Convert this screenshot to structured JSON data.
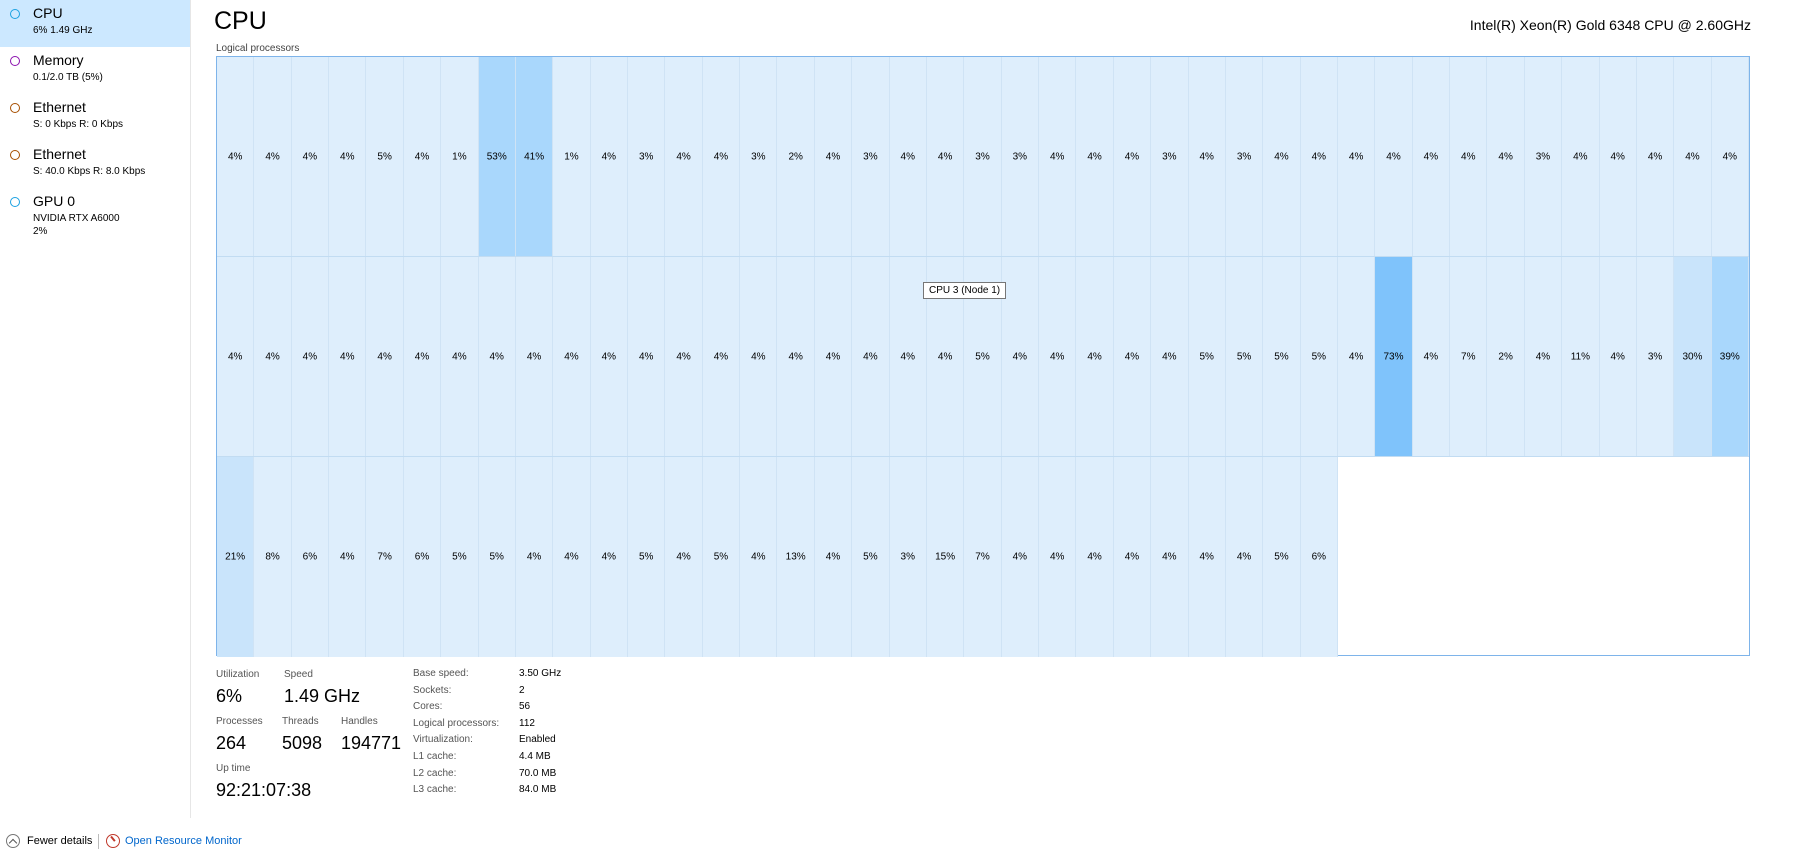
{
  "sidebar": {
    "items": [
      {
        "title": "CPU",
        "sub": "6% 1.49 GHz",
        "color": "#1ba1e2",
        "selected": true
      },
      {
        "title": "Memory",
        "sub": "0.1/2.0 TB (5%)",
        "color": "#8b12ae",
        "selected": false
      },
      {
        "title": "Ethernet",
        "sub": "S: 0 Kbps R: 0 Kbps",
        "color": "#a74f01",
        "selected": false
      },
      {
        "title": "Ethernet",
        "sub": "S: 40.0 Kbps R: 8.0 Kbps",
        "color": "#a74f01",
        "selected": false
      },
      {
        "title": "GPU 0",
        "sub": "NVIDIA RTX A6000\n2%",
        "color": "#1ba1e2",
        "selected": false
      }
    ]
  },
  "header": {
    "title": "CPU",
    "model": "Intel(R) Xeon(R) Gold 6348 CPU @ 2.60GHz",
    "grid_label": "Logical processors"
  },
  "grid": {
    "rows": [
      [
        "4%",
        "4%",
        "4%",
        "4%",
        "5%",
        "4%",
        "1%",
        "53%",
        "41%",
        "1%",
        "4%",
        "3%",
        "4%",
        "4%",
        "3%",
        "2%",
        "4%",
        "3%",
        "4%",
        "4%",
        "3%",
        "3%",
        "4%",
        "4%",
        "4%",
        "3%",
        "4%",
        "3%",
        "4%",
        "4%",
        "4%",
        "4%",
        "4%",
        "4%",
        "4%",
        "3%",
        "4%",
        "4%",
        "4%",
        "4%",
        "4%"
      ],
      [
        "4%",
        "4%",
        "4%",
        "4%",
        "4%",
        "4%",
        "4%",
        "4%",
        "4%",
        "4%",
        "4%",
        "4%",
        "4%",
        "4%",
        "4%",
        "4%",
        "4%",
        "4%",
        "4%",
        "4%",
        "5%",
        "4%",
        "4%",
        "4%",
        "4%",
        "4%",
        "5%",
        "5%",
        "5%",
        "5%",
        "4%",
        "73%",
        "4%",
        "7%",
        "2%",
        "4%",
        "11%",
        "4%",
        "3%",
        "30%",
        "39%"
      ],
      [
        "21%",
        "8%",
        "6%",
        "4%",
        "7%",
        "6%",
        "5%",
        "5%",
        "4%",
        "4%",
        "4%",
        "5%",
        "4%",
        "5%",
        "4%",
        "13%",
        "4%",
        "5%",
        "3%",
        "15%",
        "7%",
        "4%",
        "4%",
        "4%",
        "4%",
        "4%",
        "4%",
        "4%",
        "5%",
        "6%"
      ]
    ],
    "tooltip": "CPU 3 (Node 1)"
  },
  "stats": {
    "utilization_label": "Utilization",
    "utilization": "6%",
    "speed_label": "Speed",
    "speed": "1.49 GHz",
    "processes_label": "Processes",
    "processes": "264",
    "threads_label": "Threads",
    "threads": "5098",
    "handles_label": "Handles",
    "handles": "194771",
    "uptime_label": "Up time",
    "uptime": "92:21:07:38"
  },
  "specs": [
    {
      "label": "Base speed:",
      "value": "3.50 GHz"
    },
    {
      "label": "Sockets:",
      "value": "2"
    },
    {
      "label": "Cores:",
      "value": "56"
    },
    {
      "label": "Logical processors:",
      "value": "112"
    },
    {
      "label": "Virtualization:",
      "value": "Enabled"
    },
    {
      "label": "L1 cache:",
      "value": "4.4 MB"
    },
    {
      "label": "L2 cache:",
      "value": "70.0 MB"
    },
    {
      "label": "L3 cache:",
      "value": "84.0 MB"
    }
  ],
  "footer": {
    "fewer_details": "Fewer details",
    "open_resource_monitor": "Open Resource Monitor"
  }
}
